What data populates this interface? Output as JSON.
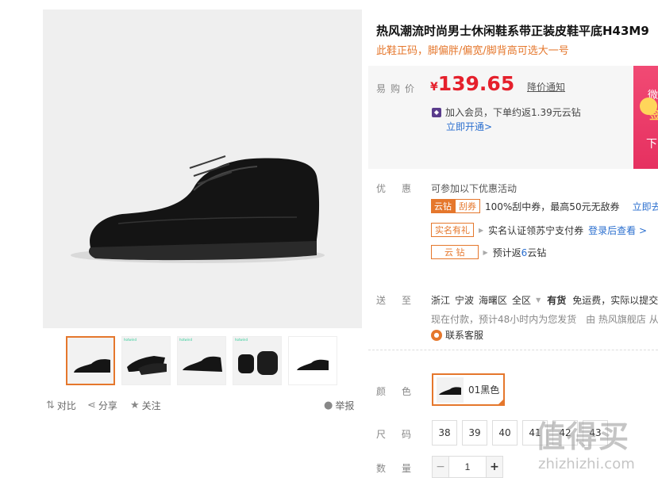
{
  "product": {
    "title": "热风潮流时尚男士休闲鞋系带正装皮鞋平底H43M9",
    "subtitle": "此鞋正码，脚偏胖/偏宽/脚背高可选大一号"
  },
  "gallery": {
    "thumb_tag": "hotwind",
    "actions": {
      "compare": "对比",
      "share": "分享",
      "follow": "关注",
      "report": "举报"
    }
  },
  "price": {
    "label": "易购价",
    "currency": "¥",
    "value": "139.65",
    "notify": "降价通知",
    "vip_text": "加入会员，下单约返1.39元云钻",
    "vip_link": "立即开通>"
  },
  "promo_banner": {
    "line1": "微",
    "line2": "签",
    "line3": "下"
  },
  "promotions": {
    "label": "优惠",
    "head": "可参加以下优惠活动",
    "items": [
      {
        "tag1": "云钻",
        "tag2": "刮券",
        "text": "100%刮中券，最高50元无敌券",
        "link": "立即去"
      },
      {
        "tag1": "实名有礼",
        "text": "实名认证领苏宁支付券",
        "link": "登录后查看 >"
      },
      {
        "tag1": "云 钻",
        "text_prefix": "预计返",
        "highlight": "6",
        "text_suffix": "云钻"
      }
    ]
  },
  "shipping": {
    "label": "送至",
    "region": [
      "浙江",
      "宁波",
      "海曙区",
      "全区"
    ],
    "stock": "有货",
    "fee": "免运费，实际以提交",
    "eta": "现在付款，预计48小时内为您发货",
    "seller": "由 热风旗舰店 从",
    "service": "联系客服"
  },
  "color": {
    "label": "颜色",
    "selected": "01黑色"
  },
  "size": {
    "label": "尺码",
    "options": [
      "38",
      "39",
      "40",
      "41",
      "42",
      "43"
    ]
  },
  "quantity": {
    "label": "数量",
    "value": "1",
    "minus": "−",
    "plus": "+"
  },
  "watermark": {
    "big": "值得买",
    "small": "zhizhizhi.com"
  },
  "colors": {
    "accent": "#e5772c",
    "price": "#e5202c",
    "link": "#2b6fcf"
  }
}
